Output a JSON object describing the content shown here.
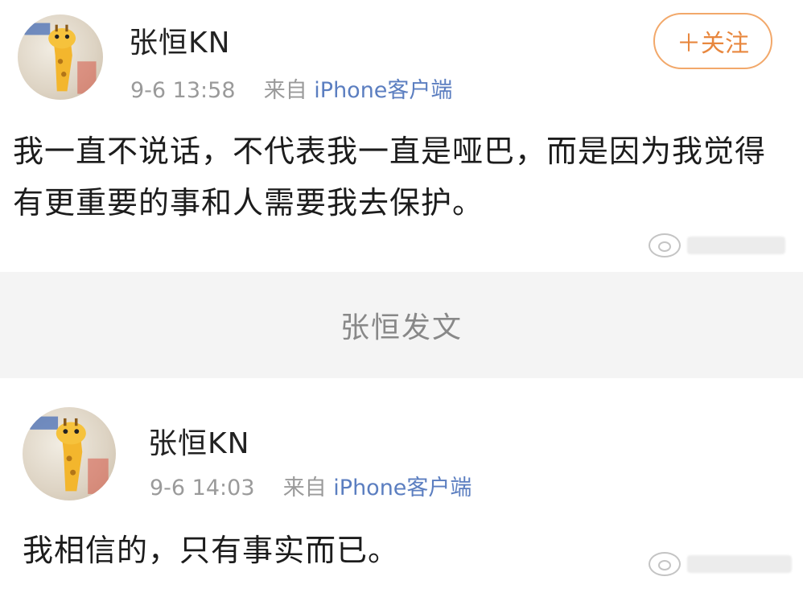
{
  "post1": {
    "username": "张恒KN",
    "time": "9-6 13:58",
    "source_prefix": "来自",
    "source": "iPhone客户端",
    "follow_label": "＋关注",
    "content": "我一直不说话，不代表我一直是哑巴，而是因为我觉得有更重要的事和人需要我去保护。"
  },
  "caption": "张恒发文",
  "post2": {
    "username": "张恒KN",
    "time": "9-6 14:03",
    "source_prefix": "来自",
    "source": "iPhone客户端",
    "content": "我相信的，只有事实而已。"
  },
  "colors": {
    "follow_accent": "#e8873e",
    "source_link": "#5b7ec0",
    "meta_gray": "#9a9a9a"
  },
  "icons": [
    "weibo-watermark-icon",
    "giraffe-avatar"
  ]
}
